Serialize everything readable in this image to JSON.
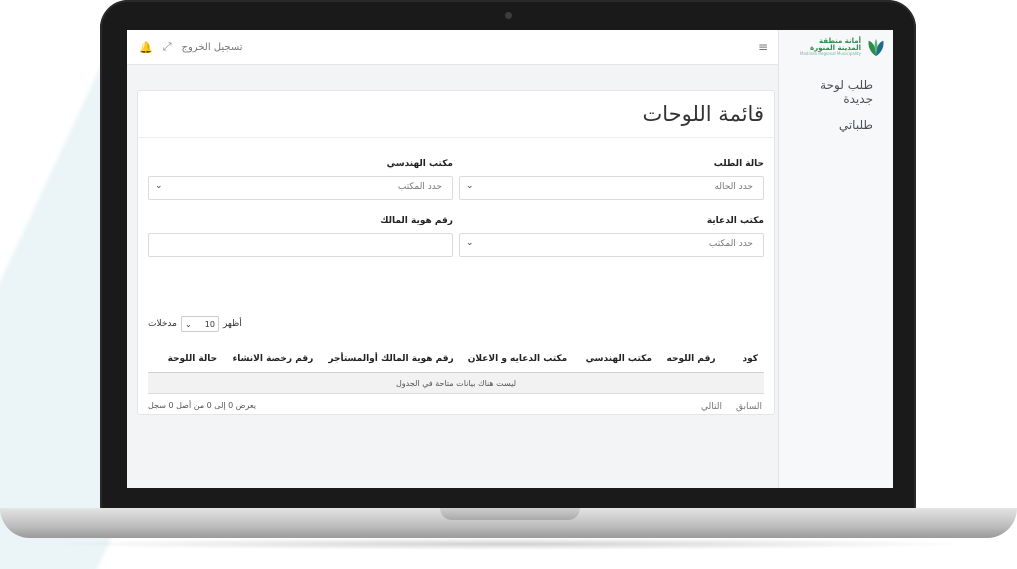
{
  "sidebar": {
    "logo": {
      "line1": "أمانة منطقة",
      "line2": "المدينة المنورة",
      "line3": "Madinah Regional Municipality"
    },
    "items": [
      {
        "label": "طلب لوحة جديدة"
      },
      {
        "label": "طلباتي"
      }
    ]
  },
  "topbar": {
    "logout_label": "تسجيل الخروج"
  },
  "main": {
    "title": "قائمة اللوحات",
    "filters": {
      "request_status": {
        "label": "حالة الطلب",
        "placeholder": "حدد الحاله"
      },
      "engineering_office": {
        "label": "مكتب الهندسي",
        "placeholder": "حدد المكتب"
      },
      "advertising_office": {
        "label": "مكتب الدعاية",
        "placeholder": "حدد المكتب"
      },
      "owner_id": {
        "label": "رقم هوية المالك",
        "value": ""
      }
    },
    "length": {
      "show_label": "أظهر",
      "value": "10",
      "entries_label": "مدخلات"
    },
    "table": {
      "columns": [
        "كود",
        "رقم اللوحه",
        "مكتب الهندسي",
        "مكتب الدعايه و الاعلان",
        "رقم هوية المالك أوالمستأجر",
        "رقم رخصة الانشاء",
        "حالة اللوحة"
      ],
      "empty_message": "ليست هناك بيانات متاحة في الجدول"
    },
    "info": "يعرض 0 إلى 0 من أصل 0 سجل",
    "pagination": {
      "previous": "السابق",
      "next": "التالي"
    }
  },
  "colors": {
    "brand_green": "#2f8a4f"
  }
}
